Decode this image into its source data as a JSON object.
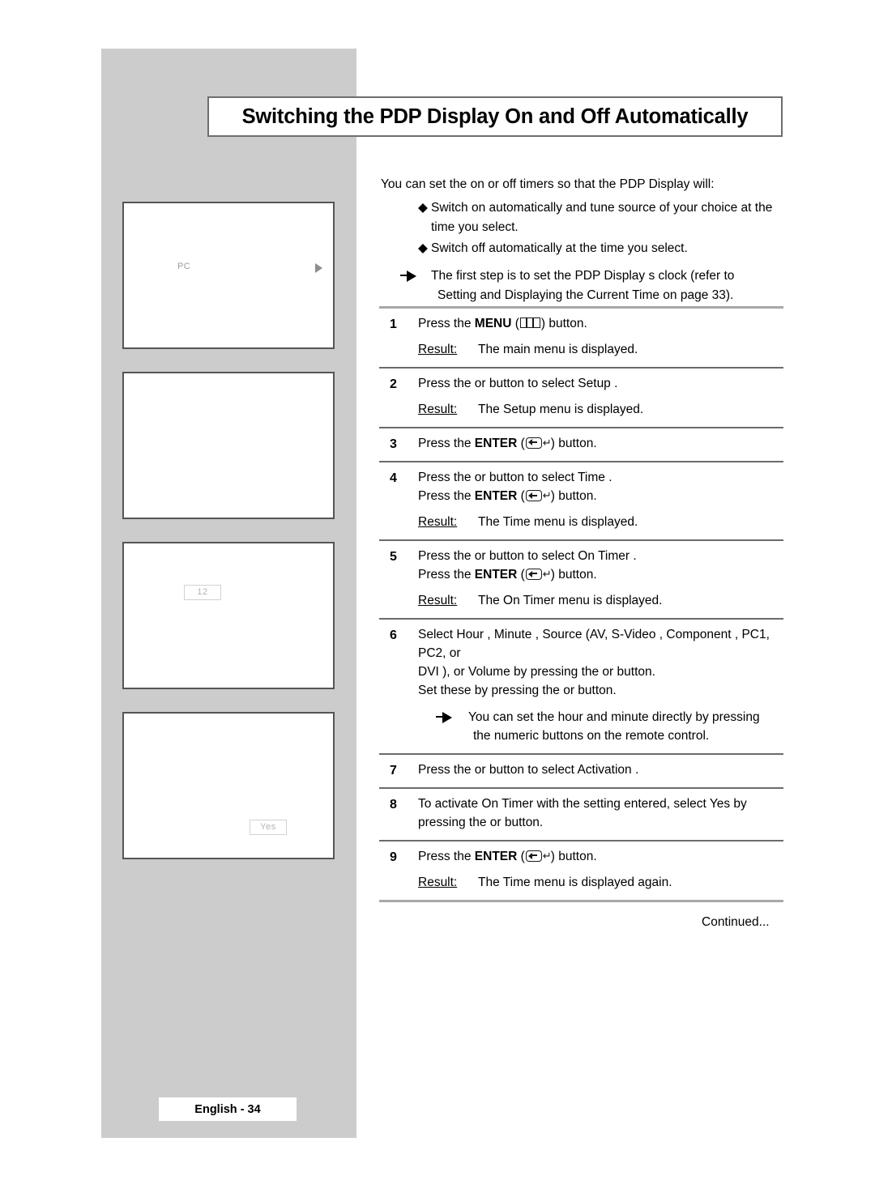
{
  "page": {
    "title": "Switching the PDP Display On and Off Automatically",
    "footer_badge": "English - 34",
    "continued": "Continued...",
    "colors": {
      "sidebar_gray": "#cccccc",
      "title_border": "#6e6e6e",
      "illus_border": "#555555",
      "rule_thick": "#a8a8a8",
      "rule_thin": "#6b6b6b",
      "osd_text": "#9a9a9a"
    }
  },
  "intro": {
    "lead": "You can set the on or off timers so that the PDP Display will:",
    "bullets": [
      {
        "mark": "◆",
        "text": "Switch on automatically and tune source of your choice at the time you select."
      },
      {
        "mark": "◆",
        "text": "Switch off automatically at the time you select."
      }
    ],
    "note": {
      "line1": "The first step is to set the PDP Display s clock (refer to",
      "line2": "Setting and Displaying the Current Time  on page 33)."
    }
  },
  "illustrations": [
    {
      "name": "on-timer-source-screen",
      "label": "PC",
      "arrow": "right-triangle"
    },
    {
      "name": "blank-screen",
      "label": ""
    },
    {
      "name": "hour-value-screen",
      "chip": "12"
    },
    {
      "name": "activation-yes-screen",
      "chip": "Yes"
    }
  ],
  "steps": [
    {
      "num": "1",
      "lines": [
        {
          "pre": "Press the ",
          "bold": "MENU",
          "mid": " (",
          "icon": "menu-icon",
          "post": ") button."
        }
      ],
      "result": {
        "label": "Result:",
        "text": "The main menu is displayed."
      }
    },
    {
      "num": "2",
      "lines": [
        {
          "plain": "Press the      or      button to select Setup ."
        }
      ],
      "result": {
        "label": "Result:",
        "text": "The Setup  menu is displayed."
      }
    },
    {
      "num": "3",
      "lines": [
        {
          "pre": "Press the ",
          "bold": "ENTER",
          "mid": " (",
          "icon": "enter-icon",
          "post": ") button."
        }
      ]
    },
    {
      "num": "4",
      "lines": [
        {
          "plain": "Press the      or      button to select Time ."
        },
        {
          "pre": "Press the ",
          "bold": "ENTER",
          "mid": " (",
          "icon": "enter-icon",
          "post": ") button."
        }
      ],
      "result": {
        "label": "Result:",
        "text": "The Time  menu is displayed."
      }
    },
    {
      "num": "5",
      "lines": [
        {
          "plain": "Press the      or      button to select On Timer  ."
        },
        {
          "pre": "Press the ",
          "bold": "ENTER",
          "mid": " (",
          "icon": "enter-icon",
          "post": ") button."
        }
      ],
      "result": {
        "label": "Result:",
        "text": "The On Timer   menu is displayed."
      }
    },
    {
      "num": "6",
      "lines": [
        {
          "plain": "Select Hour , Minute  , Source  (AV, S-Video  , Component , PC1, PC2, or"
        },
        {
          "plain": "DVI ), or Volume  by pressing the      or      button."
        },
        {
          "plain": "Set these by pressing the      or      button."
        }
      ],
      "sub_note": {
        "line1": "You can set the hour and minute directly by pressing",
        "line2": "the numeric buttons on the remote control."
      }
    },
    {
      "num": "7",
      "lines": [
        {
          "plain": "Press the     or     button to select Activation      ."
        }
      ]
    },
    {
      "num": "8",
      "lines": [
        {
          "plain": "To activate On Timer   with the setting entered, select Yes by"
        },
        {
          "plain": "pressing the     or     button."
        }
      ]
    },
    {
      "num": "9",
      "lines": [
        {
          "pre": "Press the ",
          "bold": "ENTER",
          "mid": " (",
          "icon": "enter-icon",
          "post": ") button."
        }
      ],
      "result": {
        "label": "Result:",
        "text": "The Time  menu is displayed again."
      }
    }
  ]
}
